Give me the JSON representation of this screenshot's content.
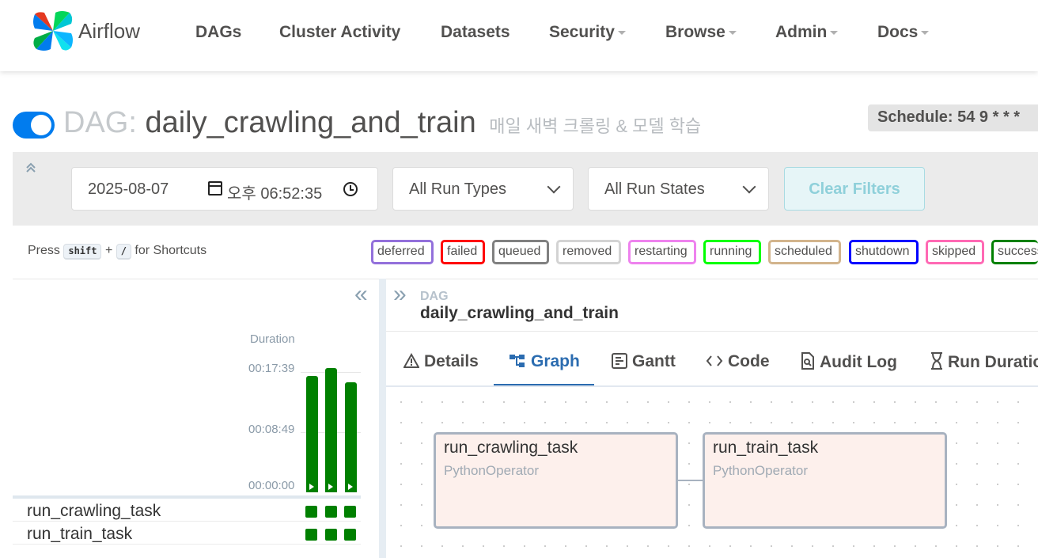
{
  "nav": {
    "brand": "Airflow",
    "items": [
      {
        "label": "DAGs",
        "caret": false
      },
      {
        "label": "Cluster Activity",
        "caret": false
      },
      {
        "label": "Datasets",
        "caret": false
      },
      {
        "label": "Security",
        "caret": true
      },
      {
        "label": "Browse",
        "caret": true
      },
      {
        "label": "Admin",
        "caret": true
      },
      {
        "label": "Docs",
        "caret": true
      }
    ]
  },
  "header": {
    "dag_label": "DAG:",
    "dag_id": "daily_crawling_and_train",
    "description": "매일 새벽 크롤링 & 모델 학습",
    "schedule": "Schedule: 54 9 * * *",
    "paused": false
  },
  "filters": {
    "date": "2025-08-07",
    "time": "오후 06:52:35",
    "run_types": "All Run Types",
    "run_states": "All Run States",
    "clear_label": "Clear Filters"
  },
  "shortcuts": {
    "press": "Press",
    "key1": "shift",
    "plus": "+",
    "key2": "/",
    "suffix": "for Shortcuts"
  },
  "states": [
    {
      "label": "deferred",
      "color": "#9370db"
    },
    {
      "label": "failed",
      "color": "#ff0000"
    },
    {
      "label": "queued",
      "color": "#808080"
    },
    {
      "label": "removed",
      "color": "#d3d3d3"
    },
    {
      "label": "restarting",
      "color": "#ee82ee"
    },
    {
      "label": "running",
      "color": "#00ff00"
    },
    {
      "label": "scheduled",
      "color": "#d2b48c"
    },
    {
      "label": "shutdown",
      "color": "#0000ff"
    },
    {
      "label": "skipped",
      "color": "#ff69b4"
    },
    {
      "label": "success",
      "color": "#008000"
    }
  ],
  "grid": {
    "duration_label": "Duration",
    "ticks": [
      "00:17:39",
      "00:08:49",
      "00:00:00"
    ],
    "run_fractions": [
      0.92,
      0.98,
      0.87
    ],
    "tasks": [
      {
        "name": "run_crawling_task",
        "states": [
          "success",
          "success",
          "success"
        ]
      },
      {
        "name": "run_train_task",
        "states": [
          "success",
          "success",
          "success"
        ]
      }
    ]
  },
  "details": {
    "crumb_label": "DAG",
    "crumb_value": "daily_crawling_and_train",
    "tabs": [
      "Details",
      "Graph",
      "Gantt",
      "Code",
      "Audit Log",
      "Run Duration"
    ],
    "active_tab": "Graph"
  },
  "graph": {
    "nodes": [
      {
        "name": "run_crawling_task",
        "type": "PythonOperator"
      },
      {
        "name": "run_train_task",
        "type": "PythonOperator"
      }
    ]
  },
  "colors": {
    "accent": "#017cee",
    "success": "#008000",
    "tab_active": "#2b6cb0"
  }
}
